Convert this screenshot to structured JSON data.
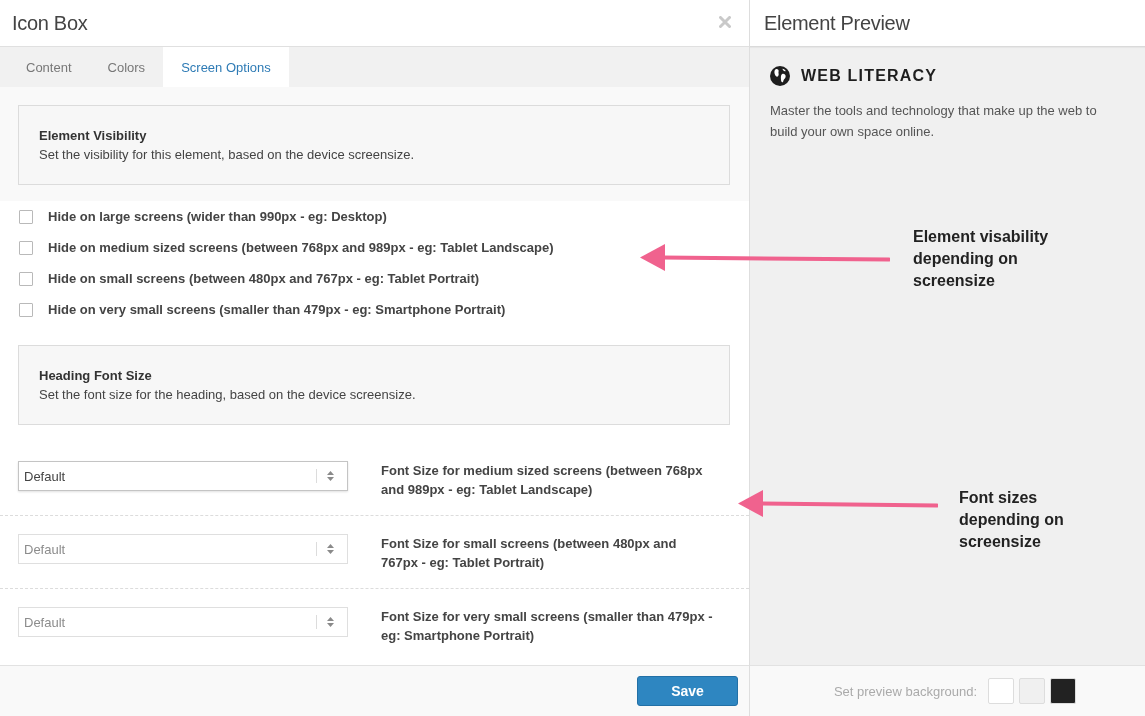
{
  "window": {
    "title": "Icon Box"
  },
  "tabs": [
    {
      "label": "Content",
      "selected": false
    },
    {
      "label": "Colors",
      "selected": false
    },
    {
      "label": "Screen Options",
      "selected": true
    }
  ],
  "sections": [
    {
      "kind": "checkboxes",
      "heading": "Element Visibility",
      "description": "Set the visibility for this element, based on the device screensize.",
      "options": [
        {
          "label": "Hide on large screens (wider than 990px - eg: Desktop)",
          "checked": false
        },
        {
          "label": "Hide on medium sized screens (between 768px and 989px - eg: Tablet Landscape)",
          "checked": false
        },
        {
          "label": "Hide on small screens (between 480px and 767px - eg: Tablet Portrait)",
          "checked": false
        },
        {
          "label": "Hide on very small screens (smaller than 479px - eg: Smartphone Portrait)",
          "checked": false
        }
      ],
      "annotation": "Element visability depending on screensize"
    },
    {
      "kind": "selects",
      "heading": "Heading Font Size",
      "description": "Set the font size for the heading, based on the device screensize.",
      "fields": [
        {
          "value": "Default",
          "label": "Font Size for medium sized screens (between 768px and 989px - eg: Tablet Landscape)",
          "disabled": false
        },
        {
          "value": "Default",
          "label": "Font Size for small screens (between 480px and 767px - eg: Tablet Portrait)",
          "disabled": true
        },
        {
          "value": "Default",
          "label": "Font Size for very small screens (smaller than 479px - eg: Smartphone Portrait)",
          "disabled": true
        }
      ],
      "annotation": "Font sizes depending on screensize"
    }
  ],
  "save_button": "Save",
  "preview": {
    "title": "Element Preview",
    "heading": "WEB LITERACY",
    "text": "Master the tools and technology that make up the web to build your own space online.",
    "background_label": "Set preview background:",
    "swatches": [
      {
        "color": "#ffffff"
      },
      {
        "color": "#f0f0f0"
      },
      {
        "color": "#222222"
      }
    ]
  }
}
